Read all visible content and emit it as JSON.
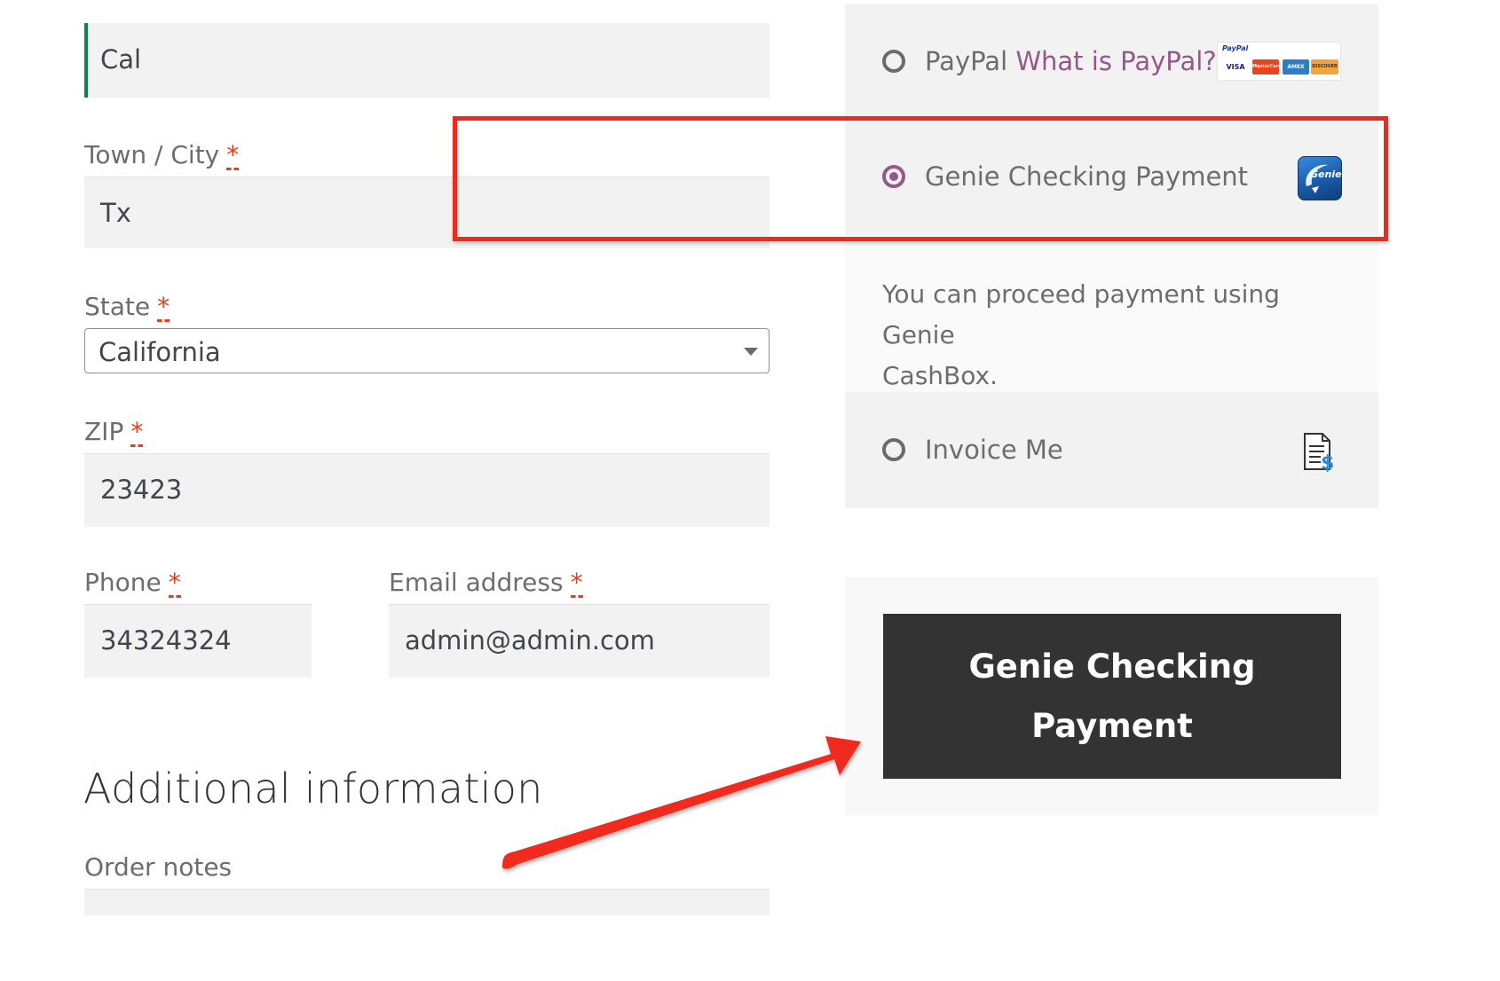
{
  "form": {
    "address_value": "Cal",
    "town_label": "Town / City",
    "town_value": "Tx",
    "state_label": "State",
    "state_value": "California",
    "zip_label": "ZIP",
    "zip_value": "23423",
    "phone_label": "Phone",
    "phone_value": "34324324",
    "email_label": "Email address",
    "email_value": "admin@admin.com",
    "required_mark": "*",
    "additional_heading": "Additional information",
    "order_notes_label": "Order notes"
  },
  "payment": {
    "methods": [
      {
        "label": "PayPal",
        "link": "What is PayPal?",
        "icon": "card-logos-icon",
        "selected": false
      },
      {
        "label": "Genie Checking Payment",
        "icon": "genie-icon",
        "selected": true
      },
      {
        "label": "Invoice Me",
        "icon": "invoice-dollar-icon",
        "selected": false
      }
    ],
    "genie_description_line1": "You can proceed payment using Genie",
    "genie_description_line2": "CashBox.",
    "place_order_line1": "Genie Checking",
    "place_order_line2": "Payment"
  },
  "icons": {
    "paypal_small_text": "PayPal",
    "visa_text": "VISA",
    "mastercard_text": "MasterCard",
    "amex_text": "AMEX",
    "discover_text": "DISCOVER",
    "genie_text": "Genie"
  },
  "colors": {
    "accent": "#96588a",
    "required": "#e2401c",
    "button": "#333333",
    "annotation": "#f02a1a",
    "focus_border": "#0f834d"
  }
}
